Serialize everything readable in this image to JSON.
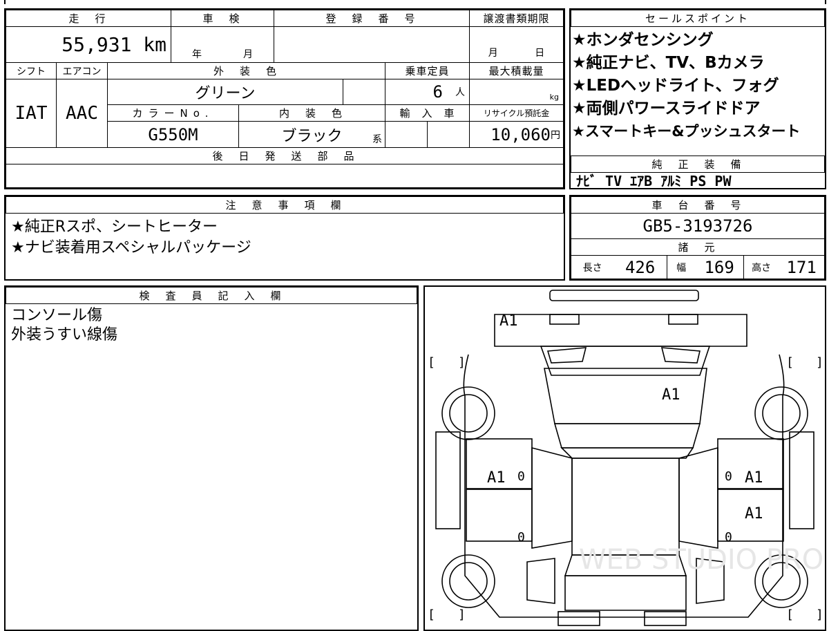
{
  "main": {
    "mileage": {
      "header": "走　行",
      "value": "55,931 km"
    },
    "inspection": {
      "header": "車　検",
      "year_unit": "年",
      "month_unit": "月"
    },
    "registration": {
      "header": "登　録　番　号"
    },
    "transfer_deadline": {
      "header": "譲渡書類期限",
      "month_unit": "月",
      "day_unit": "日"
    },
    "shift": {
      "header": "シフト",
      "value": "IAT"
    },
    "aircon": {
      "header": "エアコン",
      "value": "AAC"
    },
    "exterior_color": {
      "header": "外　装　色",
      "value": "グリーン"
    },
    "capacity": {
      "header": "乗車定員",
      "value": "6",
      "unit": "人"
    },
    "max_load": {
      "header": "最大積載量",
      "unit": "kg"
    },
    "color_no": {
      "header": "カラーNo.",
      "value": "G550M"
    },
    "interior_color": {
      "header": "内　装　色",
      "value": "ブラック",
      "suffix": "系"
    },
    "import": {
      "header": "輸　入　車"
    },
    "recycle": {
      "header": "リサイクル預託金",
      "value": "10,060",
      "unit": "円"
    },
    "later_parts": {
      "header": "後　日　発　送　部　品",
      "value": ""
    }
  },
  "sales_points": {
    "header": "セールスポイント",
    "items": [
      "★ホンダセンシング",
      "★純正ナビ、TV、Bカメラ",
      "★LEDヘッドライト、フォグ",
      "★両側パワースライドドア",
      "★スマートキー&プッシュスタート"
    ]
  },
  "equipment": {
    "header": "純　正　装　備",
    "value": "ﾅﾋﾞ TV ｴｱB ｱﾙﾐ PS PW"
  },
  "notes": {
    "header": "注　意　事　項　欄",
    "lines": [
      "★純正Rスポ、シートヒーター",
      "★ナビ装着用スペシャルパッケージ"
    ]
  },
  "chassis": {
    "header": "車　台　番　号",
    "value": "GB5-3193726"
  },
  "specs": {
    "header": "諸　元",
    "length_label": "長さ",
    "length": "426",
    "width_label": "幅",
    "width": "169",
    "height_label": "高さ",
    "height": "171"
  },
  "inspector": {
    "header": "検　査　員　記　入　欄",
    "lines": [
      "コンソール傷",
      "外装うすい線傷"
    ]
  },
  "diagram": {
    "marks": {
      "rear": "A1",
      "roof": "A1",
      "left_front_door": "A1",
      "right_front_door": "A1",
      "right_rear_door": "A1"
    },
    "zero": "0",
    "bracket_open": "[",
    "bracket_close": "]",
    "watermark": "WEB STUDIO PRO"
  },
  "colors": {
    "border": "#000000",
    "watermark": "#e6e6e6"
  }
}
